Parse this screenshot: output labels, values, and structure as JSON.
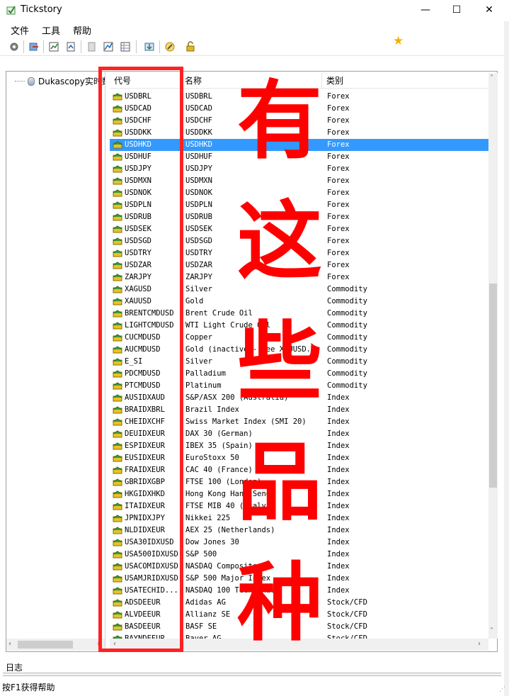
{
  "window": {
    "title": "Tickstory",
    "minimize": "—",
    "maximize": "☐",
    "close": "✕"
  },
  "menu": [
    "文件",
    "工具",
    "帮助"
  ],
  "toolbar_icons": [
    "settings-icon",
    "refresh-icon",
    "import-icon",
    "export-icon",
    "document-icon",
    "chart-icon",
    "table-icon",
    "download-icon",
    "edit-icon",
    "lock-icon"
  ],
  "tree": {
    "root_label": "Dukascopy实时数"
  },
  "columns": {
    "code": "代号",
    "name": "名称",
    "category": "类别"
  },
  "selected_symbol": "USDHKD",
  "rows": [
    [
      "USDBRL",
      "USDBRL",
      "Forex"
    ],
    [
      "USDCAD",
      "USDCAD",
      "Forex"
    ],
    [
      "USDCHF",
      "USDCHF",
      "Forex"
    ],
    [
      "USDDKK",
      "USDDKK",
      "Forex"
    ],
    [
      "USDHKD",
      "USDHKD",
      "Forex"
    ],
    [
      "USDHUF",
      "USDHUF",
      "Forex"
    ],
    [
      "USDJPY",
      "USDJPY",
      "Forex"
    ],
    [
      "USDMXN",
      "USDMXN",
      "Forex"
    ],
    [
      "USDNOK",
      "USDNOK",
      "Forex"
    ],
    [
      "USDPLN",
      "USDPLN",
      "Forex"
    ],
    [
      "USDRUB",
      "USDRUB",
      "Forex"
    ],
    [
      "USDSEK",
      "USDSEK",
      "Forex"
    ],
    [
      "USDSGD",
      "USDSGD",
      "Forex"
    ],
    [
      "USDTRY",
      "USDTRY",
      "Forex"
    ],
    [
      "USDZAR",
      "USDZAR",
      "Forex"
    ],
    [
      "ZARJPY",
      "ZARJPY",
      "Forex"
    ],
    [
      "XAGUSD",
      "Silver",
      "Commodity"
    ],
    [
      "XAUUSD",
      "Gold",
      "Commodity"
    ],
    [
      "BRENTCMDUSD",
      "Brent Crude Oil",
      "Commodity"
    ],
    [
      "LIGHTCMDUSD",
      "WTI Light Crude Oil",
      "Commodity"
    ],
    [
      "CUCMDUSD",
      "Copper",
      "Commodity"
    ],
    [
      "AUCMDUSD",
      "Gold (inactive - see XAUUSD...",
      "Commodity"
    ],
    [
      "E_SI",
      "Silver",
      "Commodity"
    ],
    [
      "PDCMDUSD",
      "Palladium",
      "Commodity"
    ],
    [
      "PTCMDUSD",
      "Platinum",
      "Commodity"
    ],
    [
      "AUSIDXAUD",
      "S&P/ASX 200 (Australia)",
      "Index"
    ],
    [
      "BRAIDXBRL",
      "Brazil Index",
      "Index"
    ],
    [
      "CHEIDXCHF",
      "Swiss Market Index (SMI 20)",
      "Index"
    ],
    [
      "DEUIDXEUR",
      "DAX 30 (German)",
      "Index"
    ],
    [
      "ESPIDXEUR",
      "IBEX 35 (Spain)",
      "Index"
    ],
    [
      "EUSIDXEUR",
      "EuroStoxx 50",
      "Index"
    ],
    [
      "FRAIDXEUR",
      "CAC 40 (France)",
      "Index"
    ],
    [
      "GBRIDXGBP",
      "FTSE 100 (London)",
      "Index"
    ],
    [
      "HKGIDXHKD",
      "Hong Kong Hang Seng",
      "Index"
    ],
    [
      "ITAIDXEUR",
      "FTSE MIB 40 (Italy)",
      "Index"
    ],
    [
      "JPNIDXJPY",
      "Nikkei 225",
      "Index"
    ],
    [
      "NLDIDXEUR",
      "AEX 25 (Netherlands)",
      "Index"
    ],
    [
      "USA30IDXUSD",
      "Dow Jones 30",
      "Index"
    ],
    [
      "USA500IDXUSD",
      "S&P 500",
      "Index"
    ],
    [
      "USACOMIDXUSD",
      "NASDAQ Composite",
      "Index"
    ],
    [
      "USAMJRIDXUSD",
      "S&P 500 Major Index",
      "Index"
    ],
    [
      "USATECHID...",
      "NASDAQ 100 Tech Index",
      "Index"
    ],
    [
      "ADSDEEUR",
      "Adidas AG",
      "Stock/CFD"
    ],
    [
      "ALVDEEUR",
      "Allianz SE",
      "Stock/CFD"
    ],
    [
      "BASDEEUR",
      "BASF SE",
      "Stock/CFD"
    ],
    [
      "BAYNDEEUR",
      "Bayer AG",
      "Stock/CFD"
    ]
  ],
  "log_label": "日志",
  "status_text": "按F1获得帮助",
  "annotation": {
    "chars": [
      "有",
      "这",
      "些",
      "品",
      "种"
    ],
    "color": "#ff0000"
  },
  "colors": {
    "selection": "#3399ff",
    "annotation": "#ff2222"
  }
}
